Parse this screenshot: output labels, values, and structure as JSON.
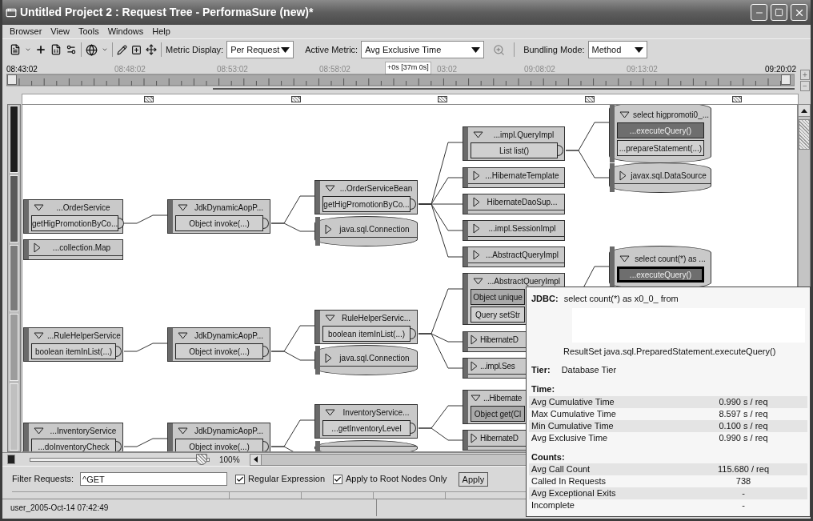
{
  "window": {
    "title": "Untitled Project 2 : Request Tree - PerformaSure (new)*"
  },
  "menu": [
    "Browser",
    "View",
    "Tools",
    "Windows",
    "Help"
  ],
  "toolbar": {
    "metric_display": {
      "label": "Metric Display:",
      "value": "Per Request"
    },
    "active_metric": {
      "label": "Active Metric:",
      "value": "Avg Exclusive Time"
    },
    "bundling_mode": {
      "label": "Bundling Mode:",
      "value": "Method"
    }
  },
  "timeline": {
    "start": "08:43:02",
    "ticks": [
      "08:48:02",
      "08:53:02",
      "08:58:02",
      "03:02",
      "09:08:02",
      "09:13:02"
    ],
    "cursor": "+0s [37m 0s]",
    "end": "09:20:02",
    "zoom_in": "+",
    "zoom_out": "−"
  },
  "tree": {
    "nodes": [
      {
        "kind": "class",
        "title": "...OrderService",
        "expanded": true,
        "methods": [
          {
            "label": "getHigPromotionByCo...",
            "kind": "plain",
            "selected": false
          }
        ]
      },
      {
        "kind": "class",
        "title": "...collection.Map",
        "expanded": false
      },
      {
        "kind": "class",
        "title": "JdkDynamicAopP...",
        "expanded": true,
        "methods": [
          {
            "label": "Object invoke(...)",
            "kind": "plain",
            "selected": false
          }
        ]
      },
      {
        "kind": "class",
        "title": "...OrderServiceBean",
        "expanded": true,
        "methods": [
          {
            "label": "getHigPromotionByCo...",
            "kind": "plain",
            "selected": false
          }
        ]
      },
      {
        "kind": "db",
        "title": "java.sql.Connection",
        "expanded": false
      },
      {
        "kind": "class",
        "title": "...impl.QueryImpl",
        "expanded": true,
        "methods": [
          {
            "label": "List list()",
            "kind": "plain",
            "selected": false
          }
        ]
      },
      {
        "kind": "class",
        "title": "...HibernateTemplate",
        "expanded": false
      },
      {
        "kind": "class",
        "title": "HibernateDaoSup...",
        "expanded": false
      },
      {
        "kind": "class",
        "title": "...impl.SessionImpl",
        "expanded": false
      },
      {
        "kind": "class",
        "title": "...AbstractQueryImpl",
        "expanded": false
      },
      {
        "kind": "db",
        "title": "select higpromoti0_...",
        "expanded": true,
        "methods": [
          {
            "label": "...executeQuery()",
            "kind": "hot",
            "selected": false
          },
          {
            "label": "...prepareStatement(...)",
            "kind": "plain",
            "selected": false
          }
        ]
      },
      {
        "kind": "db",
        "title": "javax.sql.DataSource",
        "expanded": false
      },
      {
        "kind": "db",
        "title": "select count(*) as ...",
        "expanded": true,
        "methods": [
          {
            "label": "...executeQuery()",
            "kind": "hot",
            "selected": true
          }
        ]
      },
      {
        "kind": "class",
        "title": "...AbstractQueryImpl",
        "expanded": true,
        "methods": [
          {
            "label": "Object unique",
            "kind": "warm",
            "selected": false
          },
          {
            "label": "Query setStr",
            "kind": "plain",
            "selected": false
          }
        ]
      },
      {
        "kind": "class",
        "title": "...RuleHelperService",
        "expanded": true,
        "methods": [
          {
            "label": "boolean itemInList(...)",
            "kind": "plain",
            "selected": false
          }
        ]
      },
      {
        "kind": "class",
        "title": "JdkDynamicAopP...",
        "expanded": true,
        "methods": [
          {
            "label": "Object invoke(...)",
            "kind": "plain",
            "selected": false
          }
        ]
      },
      {
        "kind": "class",
        "title": "RuleHelperServic...",
        "expanded": true,
        "methods": [
          {
            "label": "boolean itemInList(...)",
            "kind": "plain",
            "selected": false
          }
        ]
      },
      {
        "kind": "db",
        "title": "java.sql.Connection",
        "expanded": false
      },
      {
        "kind": "class",
        "title": "HibernateD",
        "expanded": false
      },
      {
        "kind": "class",
        "title": "...impl.Ses",
        "expanded": false
      },
      {
        "kind": "class",
        "title": "...InventoryService",
        "expanded": true,
        "methods": [
          {
            "label": "...doInventoryCheck",
            "kind": "plain",
            "selected": false
          }
        ]
      },
      {
        "kind": "class",
        "title": "JdkDynamicAopP...",
        "expanded": true,
        "methods": [
          {
            "label": "Object invoke(...)",
            "kind": "plain",
            "selected": false
          }
        ]
      },
      {
        "kind": "class",
        "title": "InventoryService...",
        "expanded": true,
        "methods": [
          {
            "label": "...getInventoryLevel",
            "kind": "plain",
            "selected": false
          }
        ]
      },
      {
        "kind": "db"
      },
      {
        "kind": "class",
        "title": "...Hibernate",
        "expanded": true,
        "methods": [
          {
            "label": "Object get(Cl",
            "kind": "warm",
            "selected": false
          }
        ]
      },
      {
        "kind": "class",
        "title": "HibernateD",
        "expanded": false
      }
    ]
  },
  "zoom": {
    "level": 0.96,
    "reading": "100%"
  },
  "filter": {
    "label": "Filter Requests:",
    "value": "^GET",
    "options": [
      {
        "label": "Regular Expression",
        "checked": true
      },
      {
        "label": "Apply to Root Nodes Only",
        "checked": true
      }
    ],
    "apply": "Apply"
  },
  "status_bar": {
    "text": "user_2005-Oct-14 07:42:49"
  },
  "tooltip": {
    "jdbc_label": "JDBC:",
    "query": "select count(*) as x0_0_ from",
    "method": "ResultSet java.sql.PreparedStatement.executeQuery()",
    "tier_label": "Tier:",
    "tier": "Database Tier",
    "sections": [
      {
        "title": "Time:",
        "rows": [
          {
            "label": "Avg Cumulative Time",
            "value": "0.990 s / req"
          },
          {
            "label": "Max Cumulative Time",
            "value": "8.597 s / req"
          },
          {
            "label": "Min Cumulative Time",
            "value": "0.100 s / req"
          },
          {
            "label": "Avg Exclusive Time",
            "value": "0.990 s / req"
          }
        ]
      },
      {
        "title": "Counts:",
        "rows": [
          {
            "label": "Avg Call Count",
            "value": "115.680 / req"
          },
          {
            "label": "Called In Requests",
            "value": "738"
          },
          {
            "label": "Avg Exceptional Exits",
            "value": "-"
          },
          {
            "label": "Incomplete",
            "value": "-"
          }
        ]
      }
    ]
  }
}
